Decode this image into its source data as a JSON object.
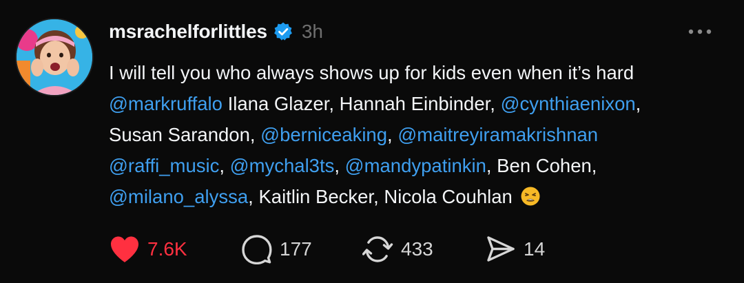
{
  "post": {
    "username": "msrachelforlittles",
    "time": "3h",
    "verified": true,
    "body_lines": [
      [
        {
          "text": "I will tell you who always shows up for kids even when it’s hard",
          "type": "text"
        }
      ],
      [
        {
          "text": "@markruffalo",
          "type": "mention"
        },
        {
          "text": " Ilana Glazer, Hannah Einbinder, ",
          "type": "text"
        },
        {
          "text": "@cynthiaenixon",
          "type": "mention"
        },
        {
          "text": ",",
          "type": "text"
        }
      ],
      [
        {
          "text": "Susan Sarandon, ",
          "type": "text"
        },
        {
          "text": "@berniceaking",
          "type": "mention"
        },
        {
          "text": ", ",
          "type": "text"
        },
        {
          "text": "@maitreyiramakrishnan",
          "type": "mention"
        }
      ],
      [
        {
          "text": "@raffi_music",
          "type": "mention"
        },
        {
          "text": ", ",
          "type": "text"
        },
        {
          "text": "@mychal3ts",
          "type": "mention"
        },
        {
          "text": ", ",
          "type": "text"
        },
        {
          "text": "@mandypatinkin",
          "type": "mention"
        },
        {
          "text": ", Ben Cohen,",
          "type": "text"
        }
      ],
      [
        {
          "text": "@milano_alyssa",
          "type": "mention"
        },
        {
          "text": ", Kaitlin Becker, Nicola Couhlan",
          "type": "text"
        },
        {
          "text": "weary-face-emoji",
          "type": "emoji"
        }
      ]
    ],
    "actions": {
      "likes": "7.6K",
      "replies": "177",
      "reposts": "433",
      "shares": "14"
    },
    "colors": {
      "background": "#0a0a0a",
      "text": "#f3f5f7",
      "mention": "#3f9fef",
      "like": "#ff3040",
      "muted": "#6f6f6f",
      "verified": "#1d9bf0"
    },
    "icons": [
      "verified-badge-icon",
      "more-icon",
      "heart-icon",
      "reply-icon",
      "repost-icon",
      "share-icon"
    ]
  }
}
